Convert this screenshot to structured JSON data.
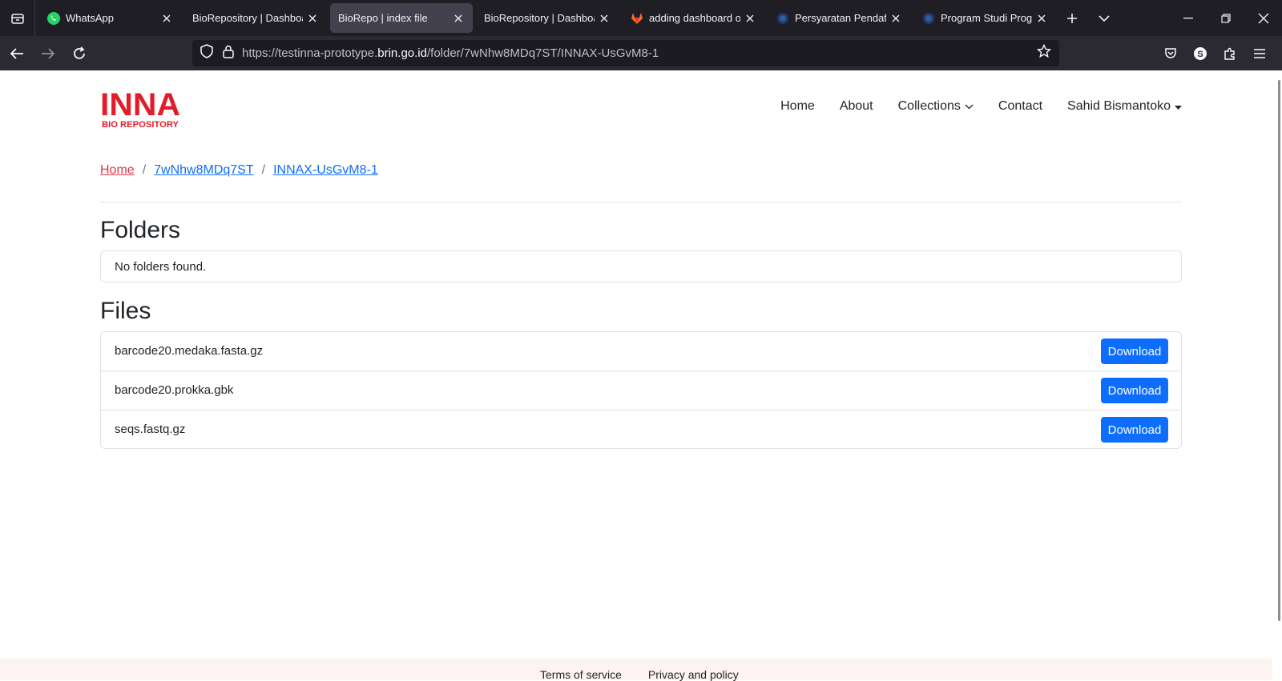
{
  "browser": {
    "tabs": [
      {
        "title": "WhatsApp",
        "icon": "whatsapp-icon",
        "active": false
      },
      {
        "title": "BioRepository | Dashboard",
        "icon": "",
        "active": false
      },
      {
        "title": "BioRepo | index file",
        "icon": "",
        "active": true
      },
      {
        "title": "BioRepository | Dashboard",
        "icon": "",
        "active": false
      },
      {
        "title": "adding dashboard on",
        "icon": "gitlab-icon",
        "active": false
      },
      {
        "title": "Persyaratan Pendaftaran",
        "icon": "globe-icon",
        "active": false
      },
      {
        "title": "Program Studi Program",
        "icon": "globe-icon",
        "active": false
      }
    ],
    "url_prefix": "https://testinna-prototype.",
    "url_domain": "brin.go.id",
    "url_path": "/folder/7wNhw8MDq7ST/INNAX-UsGvM8-1"
  },
  "site": {
    "logo_text": "INNA",
    "logo_subtext": "BIO REPOSITORY",
    "logo_color": "#e11d2b",
    "nav": {
      "home": "Home",
      "about": "About",
      "collections": "Collections",
      "contact": "Contact",
      "user": "Sahid Bismantoko"
    }
  },
  "breadcrumb": {
    "home": "Home",
    "folder": "7wNhw8MDq7ST",
    "subfolder": "INNAX-UsGvM8-1"
  },
  "folders": {
    "heading": "Folders",
    "empty_message": "No folders found."
  },
  "files": {
    "heading": "Files",
    "download_label": "Download",
    "items": [
      {
        "name": "barcode20.medaka.fasta.gz"
      },
      {
        "name": "barcode20.prokka.gbk"
      },
      {
        "name": "seqs.fastq.gz"
      }
    ]
  },
  "footer": {
    "terms": "Terms of service",
    "privacy": "Privacy and policy"
  },
  "colors": {
    "primary": "#0d6efd",
    "danger": "#dc3545",
    "chrome_dark": "#1f1e25"
  }
}
